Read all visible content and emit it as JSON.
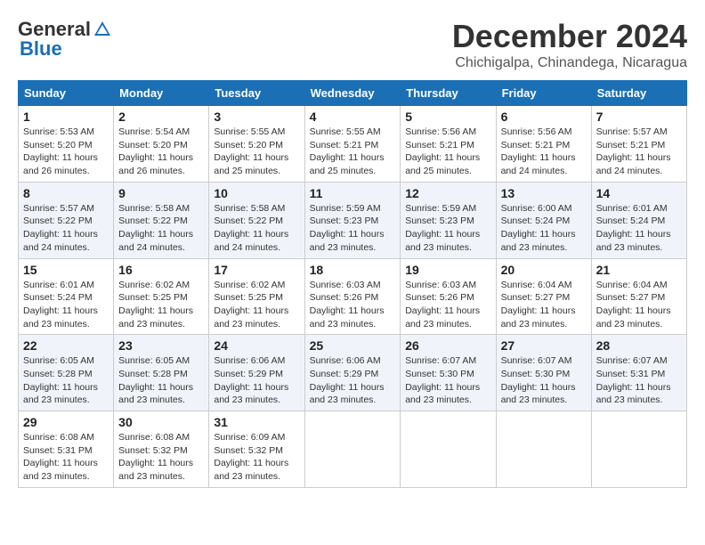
{
  "logo": {
    "general": "General",
    "blue": "Blue"
  },
  "title": {
    "month": "December 2024",
    "location": "Chichigalpa, Chinandega, Nicaragua"
  },
  "weekdays": [
    "Sunday",
    "Monday",
    "Tuesday",
    "Wednesday",
    "Thursday",
    "Friday",
    "Saturday"
  ],
  "weeks": [
    [
      {
        "day": "1",
        "sunrise": "5:53 AM",
        "sunset": "5:20 PM",
        "daylight": "11 hours and 26 minutes."
      },
      {
        "day": "2",
        "sunrise": "5:54 AM",
        "sunset": "5:20 PM",
        "daylight": "11 hours and 26 minutes."
      },
      {
        "day": "3",
        "sunrise": "5:55 AM",
        "sunset": "5:20 PM",
        "daylight": "11 hours and 25 minutes."
      },
      {
        "day": "4",
        "sunrise": "5:55 AM",
        "sunset": "5:21 PM",
        "daylight": "11 hours and 25 minutes."
      },
      {
        "day": "5",
        "sunrise": "5:56 AM",
        "sunset": "5:21 PM",
        "daylight": "11 hours and 25 minutes."
      },
      {
        "day": "6",
        "sunrise": "5:56 AM",
        "sunset": "5:21 PM",
        "daylight": "11 hours and 24 minutes."
      },
      {
        "day": "7",
        "sunrise": "5:57 AM",
        "sunset": "5:21 PM",
        "daylight": "11 hours and 24 minutes."
      }
    ],
    [
      {
        "day": "8",
        "sunrise": "5:57 AM",
        "sunset": "5:22 PM",
        "daylight": "11 hours and 24 minutes."
      },
      {
        "day": "9",
        "sunrise": "5:58 AM",
        "sunset": "5:22 PM",
        "daylight": "11 hours and 24 minutes."
      },
      {
        "day": "10",
        "sunrise": "5:58 AM",
        "sunset": "5:22 PM",
        "daylight": "11 hours and 24 minutes."
      },
      {
        "day": "11",
        "sunrise": "5:59 AM",
        "sunset": "5:23 PM",
        "daylight": "11 hours and 23 minutes."
      },
      {
        "day": "12",
        "sunrise": "5:59 AM",
        "sunset": "5:23 PM",
        "daylight": "11 hours and 23 minutes."
      },
      {
        "day": "13",
        "sunrise": "6:00 AM",
        "sunset": "5:24 PM",
        "daylight": "11 hours and 23 minutes."
      },
      {
        "day": "14",
        "sunrise": "6:01 AM",
        "sunset": "5:24 PM",
        "daylight": "11 hours and 23 minutes."
      }
    ],
    [
      {
        "day": "15",
        "sunrise": "6:01 AM",
        "sunset": "5:24 PM",
        "daylight": "11 hours and 23 minutes."
      },
      {
        "day": "16",
        "sunrise": "6:02 AM",
        "sunset": "5:25 PM",
        "daylight": "11 hours and 23 minutes."
      },
      {
        "day": "17",
        "sunrise": "6:02 AM",
        "sunset": "5:25 PM",
        "daylight": "11 hours and 23 minutes."
      },
      {
        "day": "18",
        "sunrise": "6:03 AM",
        "sunset": "5:26 PM",
        "daylight": "11 hours and 23 minutes."
      },
      {
        "day": "19",
        "sunrise": "6:03 AM",
        "sunset": "5:26 PM",
        "daylight": "11 hours and 23 minutes."
      },
      {
        "day": "20",
        "sunrise": "6:04 AM",
        "sunset": "5:27 PM",
        "daylight": "11 hours and 23 minutes."
      },
      {
        "day": "21",
        "sunrise": "6:04 AM",
        "sunset": "5:27 PM",
        "daylight": "11 hours and 23 minutes."
      }
    ],
    [
      {
        "day": "22",
        "sunrise": "6:05 AM",
        "sunset": "5:28 PM",
        "daylight": "11 hours and 23 minutes."
      },
      {
        "day": "23",
        "sunrise": "6:05 AM",
        "sunset": "5:28 PM",
        "daylight": "11 hours and 23 minutes."
      },
      {
        "day": "24",
        "sunrise": "6:06 AM",
        "sunset": "5:29 PM",
        "daylight": "11 hours and 23 minutes."
      },
      {
        "day": "25",
        "sunrise": "6:06 AM",
        "sunset": "5:29 PM",
        "daylight": "11 hours and 23 minutes."
      },
      {
        "day": "26",
        "sunrise": "6:07 AM",
        "sunset": "5:30 PM",
        "daylight": "11 hours and 23 minutes."
      },
      {
        "day": "27",
        "sunrise": "6:07 AM",
        "sunset": "5:30 PM",
        "daylight": "11 hours and 23 minutes."
      },
      {
        "day": "28",
        "sunrise": "6:07 AM",
        "sunset": "5:31 PM",
        "daylight": "11 hours and 23 minutes."
      }
    ],
    [
      {
        "day": "29",
        "sunrise": "6:08 AM",
        "sunset": "5:31 PM",
        "daylight": "11 hours and 23 minutes."
      },
      {
        "day": "30",
        "sunrise": "6:08 AM",
        "sunset": "5:32 PM",
        "daylight": "11 hours and 23 minutes."
      },
      {
        "day": "31",
        "sunrise": "6:09 AM",
        "sunset": "5:32 PM",
        "daylight": "11 hours and 23 minutes."
      },
      null,
      null,
      null,
      null
    ]
  ]
}
